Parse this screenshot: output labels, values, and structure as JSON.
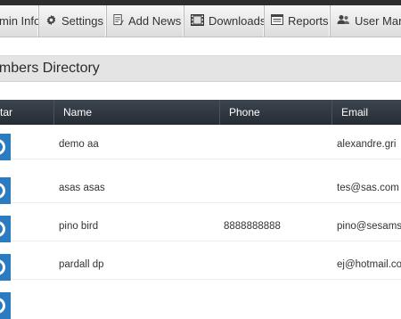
{
  "nav": {
    "tabs": [
      {
        "label": "min Info",
        "icon": "none"
      },
      {
        "label": "Settings",
        "icon": "gear-icon"
      },
      {
        "label": "Add News",
        "icon": "document-edit-icon"
      },
      {
        "label": "Downloads",
        "icon": "film-icon"
      },
      {
        "label": "Reports",
        "icon": "report-icon"
      },
      {
        "label": "User Mana",
        "icon": "users-icon"
      }
    ]
  },
  "section": {
    "title": "embers Directory"
  },
  "table": {
    "columns": [
      "tar",
      "Name",
      "Phone",
      "Email"
    ],
    "rows": [
      {
        "name": "demo aa",
        "phone": "",
        "email": "alexandre.gri"
      },
      {
        "name": "asas asas",
        "phone": "",
        "email": "tes@sas.com"
      },
      {
        "name": "pino bird",
        "phone": "8888888888",
        "email": "pino@sesams"
      },
      {
        "name": "pardall dp",
        "phone": "",
        "email": "ej@hotmail.co"
      },
      {
        "name": "",
        "phone": "",
        "email": ""
      }
    ]
  },
  "colors": {
    "accent": "#2a7bbf",
    "header_dark": "#2b3139"
  }
}
